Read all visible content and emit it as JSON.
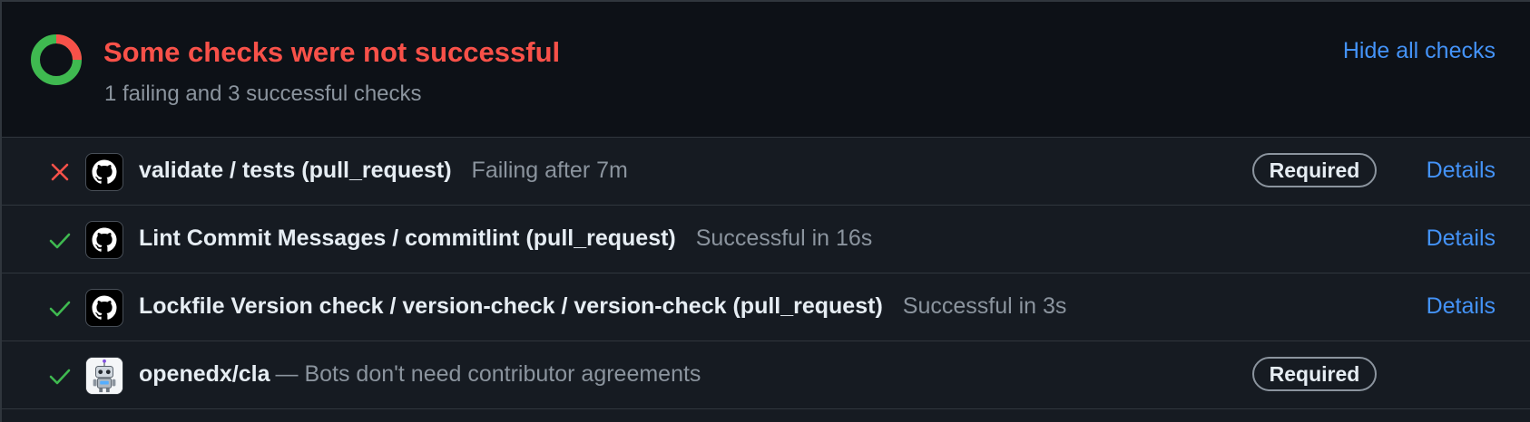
{
  "summary": {
    "title": "Some checks were not successful",
    "subtitle": "1 failing and 3 successful checks",
    "hide_label": "Hide all checks",
    "donut": {
      "failing": 1,
      "successful": 3,
      "fail_color": "#f85149",
      "success_color": "#3fb950"
    }
  },
  "checks": [
    {
      "status": "failure",
      "status_icon": "x-icon",
      "avatar": "github-icon",
      "name": "validate / tests (pull_request)",
      "description": "Failing after 7m",
      "required": "Required",
      "details": "Details"
    },
    {
      "status": "success",
      "status_icon": "check-icon",
      "avatar": "github-icon",
      "name": "Lint Commit Messages / commitlint (pull_request)",
      "description": "Successful in 16s",
      "details": "Details"
    },
    {
      "status": "success",
      "status_icon": "check-icon",
      "avatar": "github-icon",
      "name": "Lockfile Version check / version-check / version-check (pull_request)",
      "description": "Successful in 3s",
      "details": "Details"
    },
    {
      "status": "success",
      "status_icon": "check-icon",
      "avatar": "robot-icon",
      "name": "openedx/cla",
      "description": "— Bots don't need contributor agreements",
      "required": "Required"
    }
  ],
  "colors": {
    "failure": "#f85149",
    "success": "#3fb950",
    "link": "#4493f8",
    "muted": "#8b949e"
  }
}
